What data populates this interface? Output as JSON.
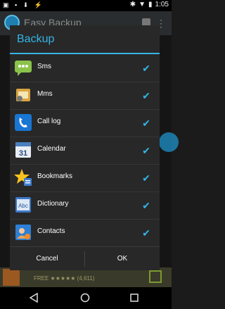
{
  "status_bar": {
    "time": "1:05"
  },
  "app": {
    "title": "Easy Backup"
  },
  "ad": {
    "text": "FREE ★★★★★ (4,611)"
  },
  "dialog": {
    "title": "Backup",
    "items": [
      {
        "label": "Sms",
        "icon": "sms-icon",
        "checked": true
      },
      {
        "label": "Mms",
        "icon": "mms-icon",
        "checked": true
      },
      {
        "label": "Call log",
        "icon": "call-log-icon",
        "checked": true
      },
      {
        "label": "Calendar",
        "icon": "calendar-icon",
        "checked": true
      },
      {
        "label": "Bookmarks",
        "icon": "bookmarks-icon",
        "checked": true
      },
      {
        "label": "Dictionary",
        "icon": "dictionary-icon",
        "checked": true
      },
      {
        "label": "Contacts",
        "icon": "contacts-icon",
        "checked": true
      }
    ],
    "cancel_label": "Cancel",
    "ok_label": "OK"
  },
  "colors": {
    "accent": "#33b5e5",
    "dialog_bg": "#282828"
  }
}
